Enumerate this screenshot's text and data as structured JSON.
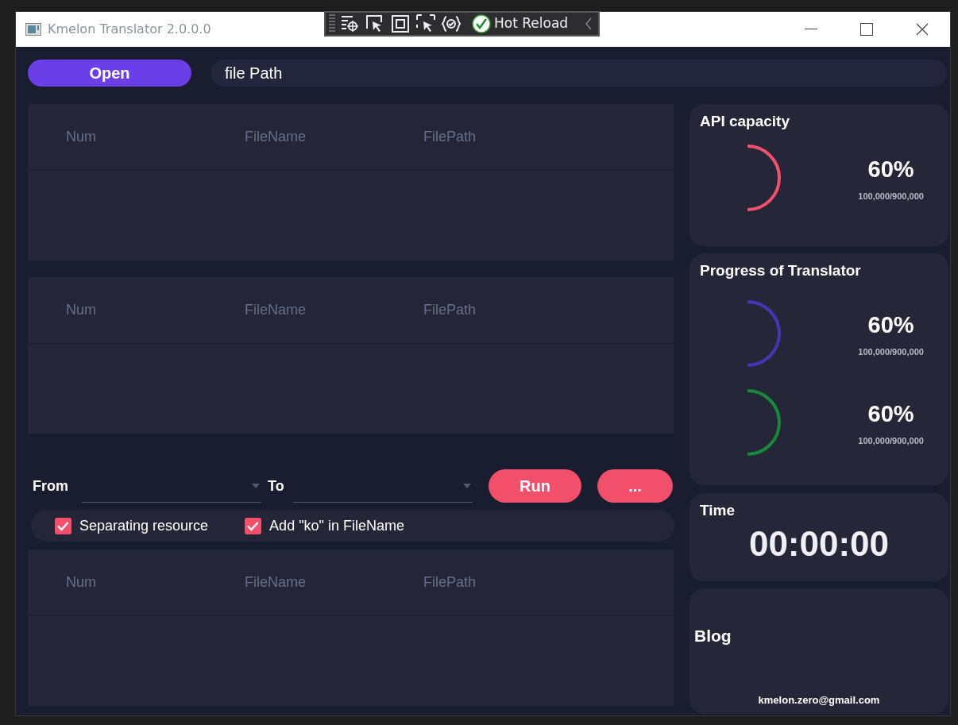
{
  "window": {
    "title": "Kmelon Translator 2.0.0.0"
  },
  "debug_toolbar": {
    "label": "Hot Reload"
  },
  "open_button": "Open",
  "file_path": {
    "value": "file Path"
  },
  "grids_top": [
    {
      "columns": [
        "Num",
        "FileName",
        "FilePath"
      ]
    },
    {
      "columns": [
        "Num",
        "FileName",
        "FilePath"
      ]
    }
  ],
  "from_label": "From",
  "to_label": "To",
  "buttons": [
    "Run",
    "..."
  ],
  "options": [
    {
      "label": "Separating resource",
      "checked": true
    },
    {
      "label": "Add \"ko\" in FileName",
      "checked": true
    }
  ],
  "grid_bottom": {
    "columns": [
      "Num",
      "FileName",
      "FilePath"
    ]
  },
  "api_card": {
    "title": "API capacity",
    "meters": [
      {
        "color": "#f2506a",
        "percent": "60%",
        "reading": "100,000/900,000"
      }
    ]
  },
  "progress_card": {
    "title": "Progress of Translator",
    "meters": [
      {
        "color": "#4a32b4",
        "percent": "60%",
        "reading": "100,000/900,000"
      },
      {
        "color": "#168a3a",
        "percent": "60%",
        "reading": "100,000/900,000"
      }
    ]
  },
  "time_card": {
    "title": "Time",
    "value": "00:00:00"
  },
  "blog_card": {
    "title": "Blog",
    "email": "kmelon.zero@gmail.com"
  }
}
